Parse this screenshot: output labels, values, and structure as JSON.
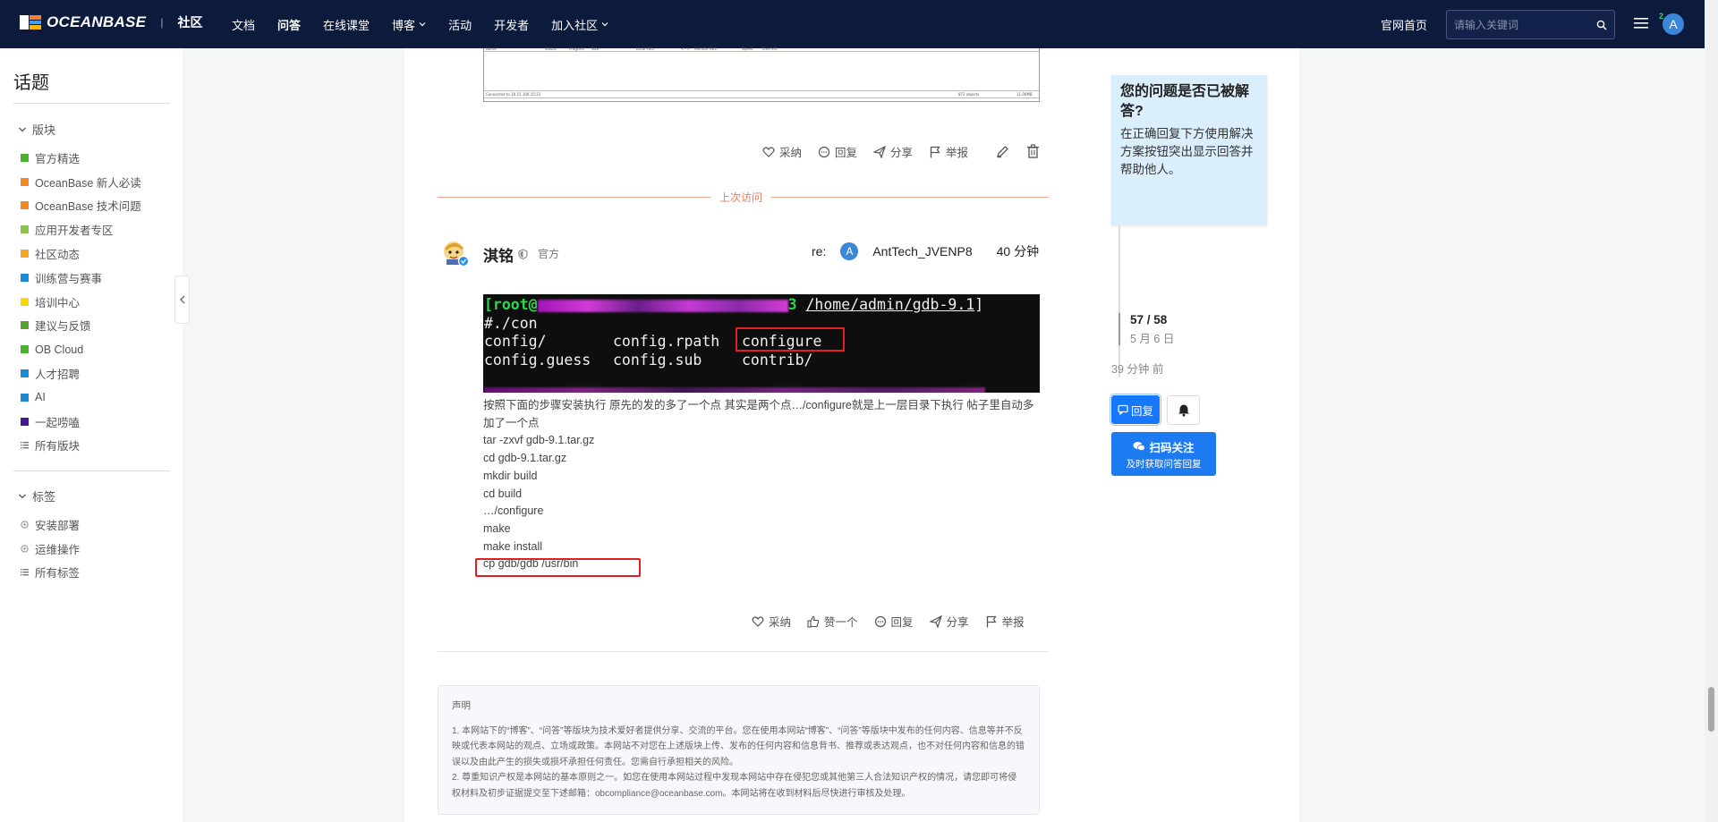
{
  "header": {
    "brand": "OCEANBASE",
    "section": "社区",
    "nav": [
      {
        "label": "文档",
        "dropdown": false,
        "active": false
      },
      {
        "label": "问答",
        "dropdown": false,
        "active": true
      },
      {
        "label": "在线课堂",
        "dropdown": false,
        "active": false
      },
      {
        "label": "博客",
        "dropdown": true,
        "active": false
      },
      {
        "label": "活动",
        "dropdown": false,
        "active": false
      },
      {
        "label": "开发者",
        "dropdown": false,
        "active": false
      },
      {
        "label": "加入社区",
        "dropdown": true,
        "active": false
      }
    ],
    "home_link": "官网首页",
    "search_placeholder": "请输入关键词",
    "notification_count": "2",
    "avatar_letter": "A"
  },
  "sidebar": {
    "title": "话题",
    "boards_label": "版块",
    "boards": [
      {
        "label": "官方精选",
        "color": "#4caf2f"
      },
      {
        "label": "OceanBase 新人必读",
        "color": "#f08a24"
      },
      {
        "label": "OceanBase 技术问题",
        "color": "#f08a24"
      },
      {
        "label": "应用开发者专区",
        "color": "#8bc34a"
      },
      {
        "label": "社区动态",
        "color": "#f5a623"
      },
      {
        "label": "训练营与赛事",
        "color": "#1b8ad6"
      },
      {
        "label": "培训中心",
        "color": "#f5d90a"
      },
      {
        "label": "建议与反馈",
        "color": "#5aa02c"
      },
      {
        "label": "OB Cloud",
        "color": "#4caf2f"
      },
      {
        "label": "人才招聘",
        "color": "#1b8ad6"
      },
      {
        "label": "AI",
        "color": "#1b8ad6"
      },
      {
        "label": "一起唠嗑",
        "color": "#3f1b8f"
      }
    ],
    "all_boards": "所有版块",
    "tags_label": "标签",
    "tags": [
      "安装部署",
      "运维操作"
    ],
    "all_tags": "所有标签"
  },
  "prev_post": {
    "actions": [
      "采纳",
      "回复",
      "分享",
      "举报"
    ],
    "shot_headers": [
      "Name",
      "Status",
      "Progress",
      "Size",
      "Local Path",
      "<-->",
      "Remote Path",
      "Speed",
      "Time left"
    ],
    "shot_footer_left": "Connected to 10.15.100.15:22",
    "shot_footer_mid": "872 objects",
    "shot_footer_right": "11.00MB"
  },
  "last_visit_label": "上次访问",
  "post": {
    "author": "淇铭",
    "role": "官方",
    "reply_prefix": "re:",
    "reply_to_avatar": "A",
    "reply_to": "AntTech_JVENP8",
    "time": "40 分钟",
    "terminal": {
      "prompt_user": "[root@",
      "prompt_host_end": "3",
      "prompt_path": "/home/admin/gdb-9.1",
      "prompt_end": "]",
      "cmd": "#./con",
      "row1": [
        "config/",
        "config.rpath",
        "configure"
      ],
      "row2": [
        "config.guess",
        "config.sub",
        "contrib/"
      ]
    },
    "lines": [
      "按照下面的步骤安装执行 原先的发的多了一个点 其实是两个点…/configure就是上一层目录下执行 帖子里自动多加了一个点",
      "tar -zxvf gdb-9.1.tar.gz",
      "cd gdb-9.1.tar.gz",
      "mkdir build",
      "cd build",
      "…/configure",
      "make",
      "make install",
      "cp gdb/gdb /usr/bin"
    ],
    "actions": [
      "采纳",
      "赞一个",
      "回复",
      "分享",
      "举报"
    ]
  },
  "notice": {
    "title": "声明",
    "p1": "1. 本网站下的“博客”、“问答”等版块为技术爱好者提供分享、交流的平台。您在使用本网站“博客”、“问答”等版块中发布的任何内容、信息等并不反映或代表本网站的观点、立场或政策。本网站不对您在上述版块上传、发布的任何内容和信息背书、推荐或表达观点，也不对任何内容和信息的错误以及由此产生的损失或损坏承担任何责任。您需自行承担相关的风险。",
    "p2": "2. 尊重知识产权是本网站的基本原则之一。如您在使用本网站过程中发现本网站中存在侵犯您或其他第三人合法知识产权的情况，请您即可将侵权材料及初步证据提交至下述邮箱：obcompliance@oceanbase.com。本网站将在收到材料后尽快进行审核及处理。"
  },
  "right": {
    "tip_title": "您的问题是否已被解答?",
    "tip_body": "在正确回复下方使用解决方案按钮突出显示回答并帮助他人。",
    "progress": "57 / 58",
    "progress_value": 0.983,
    "date": "5 月 6 日",
    "ago": "39 分钟 前",
    "reply_button": "回复",
    "wechat_l1": "扫码关注",
    "wechat_l2": "及时获取问答回复"
  },
  "colors": {
    "header_bg": "#0c1a3c",
    "accent": "#1677ff",
    "visit_line": "#ef7b5a",
    "highlight_box": "#e02020"
  }
}
